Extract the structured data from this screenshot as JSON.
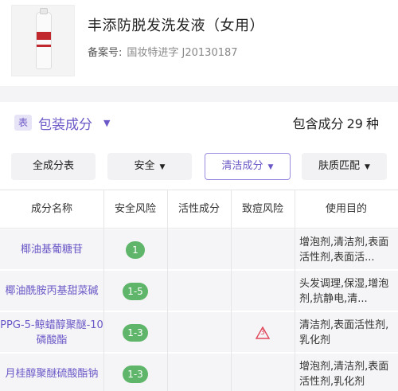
{
  "product": {
    "name": "丰添防脱发洗发液（女用）",
    "registration_label": "备案号:",
    "registration_value": "国妆特进字 J20130187"
  },
  "section": {
    "badge": "表",
    "title": "包装成分",
    "count_prefix": "包含成分",
    "count": "29",
    "count_suffix": "种"
  },
  "filters": [
    {
      "label": "全成分表",
      "has_caret": false,
      "active": false
    },
    {
      "label": "安全",
      "has_caret": true,
      "active": false
    },
    {
      "label": "清洁成分",
      "has_caret": true,
      "active": true
    },
    {
      "label": "肤质匹配",
      "has_caret": true,
      "active": false
    }
  ],
  "table": {
    "headers": [
      "成分名称",
      "安全风险",
      "活性成分",
      "致痘风险",
      "使用目的"
    ],
    "rows": [
      {
        "name": "椰油基葡糖苷",
        "risk": "1",
        "active": "",
        "acne": "",
        "purpose": "增泡剂,清洁剂,表面活性剂,表面活..."
      },
      {
        "name": "椰油酰胺丙基甜菜碱",
        "risk": "1-5",
        "active": "",
        "acne": "",
        "purpose": "头发调理,保湿,增泡剂,抗静电,清..."
      },
      {
        "name": "PPG-5-鲸蜡醇聚醚-10 磷酸酯",
        "risk": "1-3",
        "active": "",
        "acne": "3",
        "purpose": "清洁剂,表面活性剂,乳化剂"
      },
      {
        "name": "月桂醇聚醚硫酸酯钠",
        "risk": "1-3",
        "active": "",
        "acne": "",
        "purpose": "增泡剂,清洁剂,表面活性剂,乳化剂"
      }
    ]
  },
  "colors": {
    "accent": "#6c58c7",
    "risk_low": "#5fb66a",
    "acne_warning": "#e0465a"
  }
}
